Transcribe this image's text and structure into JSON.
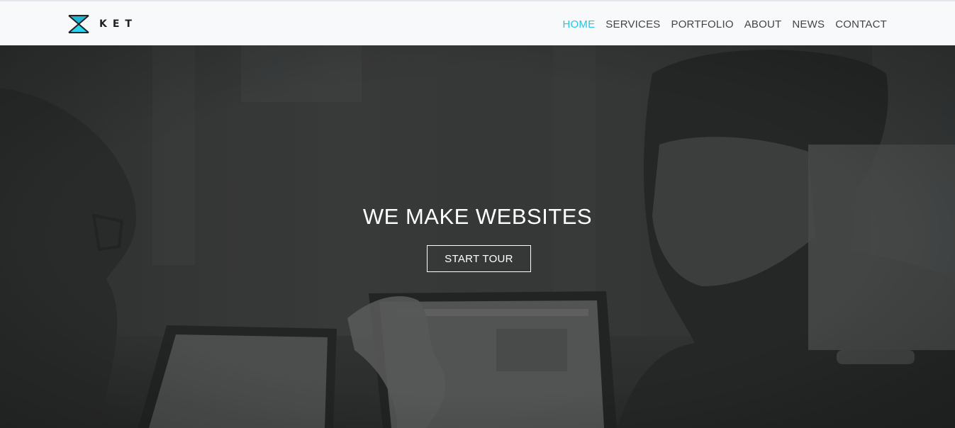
{
  "brand": {
    "name": "KET",
    "logo_icon": "hourglass-triangle-logo",
    "accent_color": "#29c6dd"
  },
  "nav": {
    "items": [
      {
        "label": "HOME",
        "active": true
      },
      {
        "label": "SERVICES",
        "active": false
      },
      {
        "label": "PORTFOLIO",
        "active": false
      },
      {
        "label": "ABOUT",
        "active": false
      },
      {
        "label": "NEWS",
        "active": false
      },
      {
        "label": "CONTACT",
        "active": false
      }
    ],
    "active_color": "#29c6dd",
    "text_color": "#444444"
  },
  "hero": {
    "title": "WE MAKE WEBSITES",
    "button_label": "START TOUR",
    "background": "grayscale photo of two people working on laptops"
  }
}
